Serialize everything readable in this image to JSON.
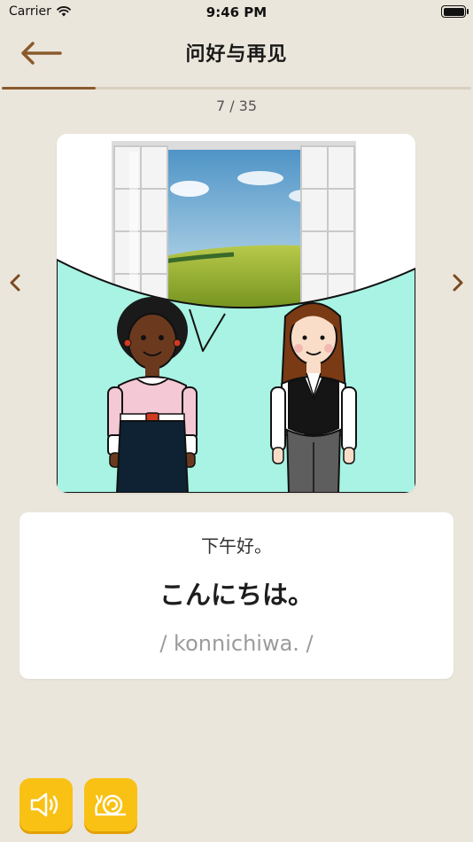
{
  "status_bar": {
    "carrier": "Carrier",
    "time": "9:46 PM"
  },
  "header": {
    "title": "问好与再见"
  },
  "progress": {
    "current": 7,
    "total": 35,
    "label": "7 / 35",
    "fraction": 0.2
  },
  "card": {
    "illustration": "two-women-greeting-with-speech-bubble-and-window-view",
    "translation": "下午好。",
    "phrase": "こんにちは。",
    "romaji": "/ konnichiwa. /"
  },
  "icons": {
    "back": "back-arrow-icon",
    "prev": "chevron-left-icon",
    "next": "chevron-right-icon",
    "audio": "speaker-icon",
    "slow": "snail-icon"
  },
  "colors": {
    "background": "#ebe6dc",
    "accent": "#8a5a2b",
    "button": "#f9c114",
    "sky_bubble": "#a8f3e3"
  }
}
